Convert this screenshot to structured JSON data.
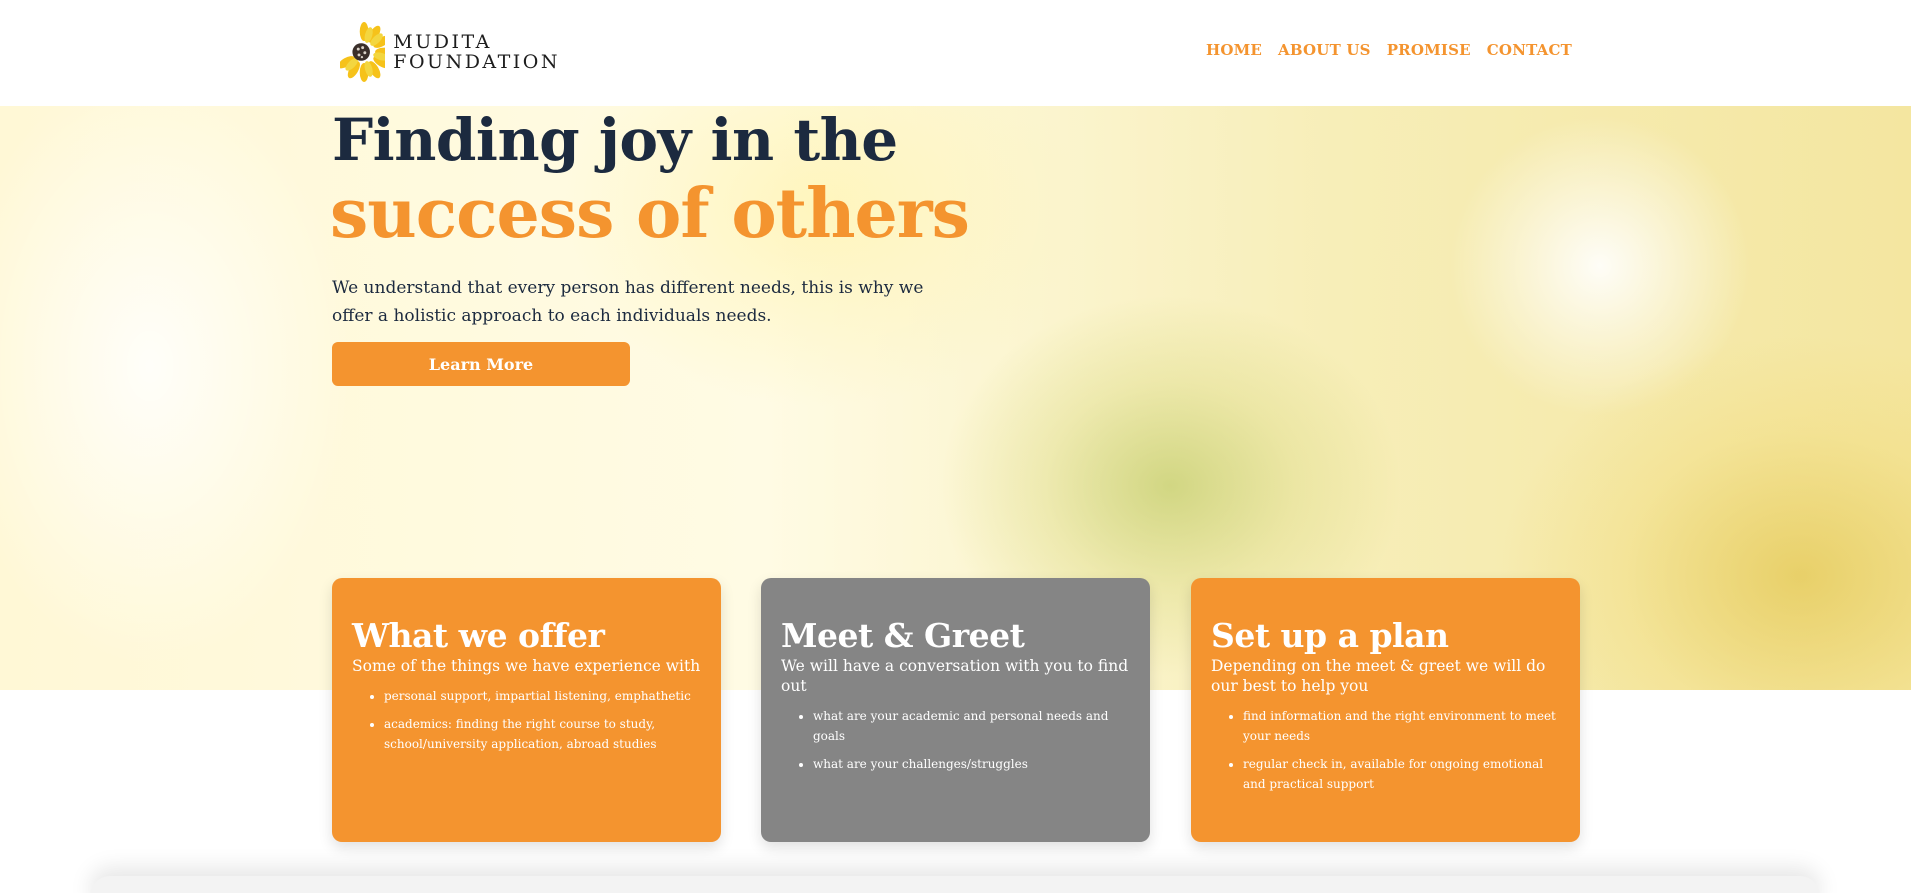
{
  "logo": {
    "line1": "MUDITA",
    "line2": "FOUNDATION",
    "icon": "sunflower-icon"
  },
  "nav": {
    "items": [
      "HOME",
      "ABOUT US",
      "PROMISE",
      "CONTACT"
    ]
  },
  "hero": {
    "title_line1": "Finding joy in the",
    "title_line2": "success of others",
    "description": "We understand that every person has different needs, this is why we offer a holistic approach to each individuals needs.",
    "button_label": "Learn More"
  },
  "cards": [
    {
      "title": "What we offer",
      "subtitle": "Some of the things we have experience with",
      "items": [
        "personal support, impartial listening, emphathetic",
        "academics: finding the right course to study, school/university application, abroad studies"
      ]
    },
    {
      "title": "Meet & Greet",
      "subtitle": "We will have a conversation with you to find out",
      "items": [
        "what are your academic and personal needs and goals",
        "what are your challenges/struggles"
      ]
    },
    {
      "title": "Set up a plan",
      "subtitle": "Depending on the meet & greet we will do our best to help you",
      "items": [
        "find information and the right environment to meet your needs",
        "regular check in, available for ongoing emotional and practical support"
      ]
    }
  ],
  "colors": {
    "accent": "#f4942f",
    "heading": "#1c2a3f",
    "card_grey": "#858585"
  }
}
